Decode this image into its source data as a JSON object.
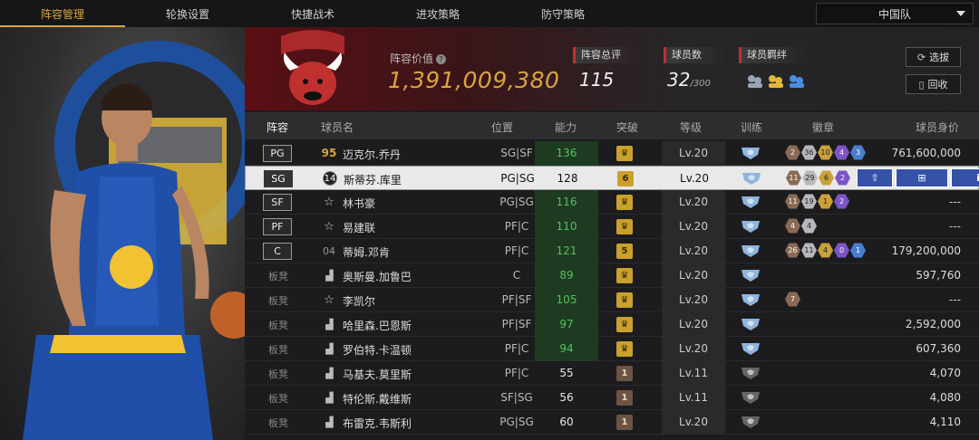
{
  "nav": {
    "tabs": [
      "阵容管理",
      "轮换设置",
      "快捷战术",
      "进攻策略",
      "防守策略"
    ],
    "team_select": "中国队"
  },
  "summary": {
    "value_label": "阵容价值",
    "value": "1,391,009,380",
    "overall_label": "阵容总评",
    "overall": "115",
    "player_count_label": "球员数",
    "player_count": "32",
    "player_count_max": "/300",
    "chemistry_label": "球员羁绊",
    "buttons": {
      "select": "选拔",
      "recycle": "回收"
    }
  },
  "table": {
    "headers": [
      "阵容",
      "球员名",
      "位置",
      "能力",
      "突破",
      "等级",
      "训练",
      "徽章",
      "球员身价"
    ],
    "rows": [
      {
        "slot": "PG",
        "rank": "95",
        "name": "迈克尔.乔丹",
        "pos": "SG|SF",
        "cap": "136",
        "brk": "♛",
        "lv": "Lv.20",
        "medals": [
          "2",
          "36",
          "10",
          "4",
          "3"
        ],
        "salary": "761,600,000"
      },
      {
        "slot": "SG",
        "rank": "14",
        "name": "斯蒂芬.库里",
        "pos": "PG|SG",
        "cap": "128",
        "brk": "6",
        "lv": "Lv.20",
        "medals": [
          "11",
          "29",
          "6",
          "2"
        ],
        "salary": ""
      },
      {
        "slot": "SF",
        "rank": "☆",
        "name": "林书豪",
        "pos": "PG|SG",
        "cap": "116",
        "brk": "♛",
        "lv": "Lv.20",
        "medals": [
          "11",
          "19",
          "1",
          "2"
        ],
        "salary": "---"
      },
      {
        "slot": "PF",
        "rank": "☆",
        "name": "易建联",
        "pos": "PF|C",
        "cap": "110",
        "brk": "♛",
        "lv": "Lv.20",
        "medals": [
          "4",
          "4"
        ],
        "salary": "---"
      },
      {
        "slot": "C",
        "rank": "04",
        "name": "蒂姆.邓肯",
        "pos": "PF|C",
        "cap": "121",
        "brk": "5",
        "lv": "Lv.20",
        "medals": [
          "26",
          "11",
          "4",
          "0",
          "1"
        ],
        "salary": "179,200,000"
      },
      {
        "slot": "板凳",
        "rank": "▟",
        "name": "奥斯曼.加鲁巴",
        "pos": "C",
        "cap": "89",
        "brk": "♛",
        "lv": "Lv.20",
        "medals": [],
        "salary": "597,760"
      },
      {
        "slot": "板凳",
        "rank": "☆",
        "name": "李凯尔",
        "pos": "PF|SF",
        "cap": "105",
        "brk": "♛",
        "lv": "Lv.20",
        "medals": [
          "7"
        ],
        "salary": "---"
      },
      {
        "slot": "板凳",
        "rank": "▟",
        "name": "哈里森.巴恩斯",
        "pos": "PF|SF",
        "cap": "97",
        "brk": "♛",
        "lv": "Lv.20",
        "medals": [],
        "salary": "2,592,000"
      },
      {
        "slot": "板凳",
        "rank": "▟",
        "name": "罗伯特.卡温顿",
        "pos": "PF|C",
        "cap": "94",
        "brk": "♛",
        "lv": "Lv.20",
        "medals": [],
        "salary": "607,360"
      },
      {
        "slot": "板凳",
        "rank": "▟",
        "name": "马基夫.莫里斯",
        "pos": "PF|C",
        "cap": "55",
        "brk": "1",
        "lv": "Lv.11",
        "medals": [],
        "salary": "4,070"
      },
      {
        "slot": "板凳",
        "rank": "▟",
        "name": "特伦斯.戴维斯",
        "pos": "SF|SG",
        "cap": "56",
        "brk": "1",
        "lv": "Lv.11",
        "medals": [],
        "salary": "4,080"
      },
      {
        "slot": "板凳",
        "rank": "▟",
        "name": "布雷克.韦斯利",
        "pos": "PG|SG",
        "cap": "60",
        "brk": "1",
        "lv": "Lv.20",
        "medals": [],
        "salary": "4,110"
      }
    ]
  },
  "colors": {
    "accent": "#d9a441",
    "green": "#4fc35a",
    "red": "#c0302f",
    "action": "#3552a8"
  }
}
